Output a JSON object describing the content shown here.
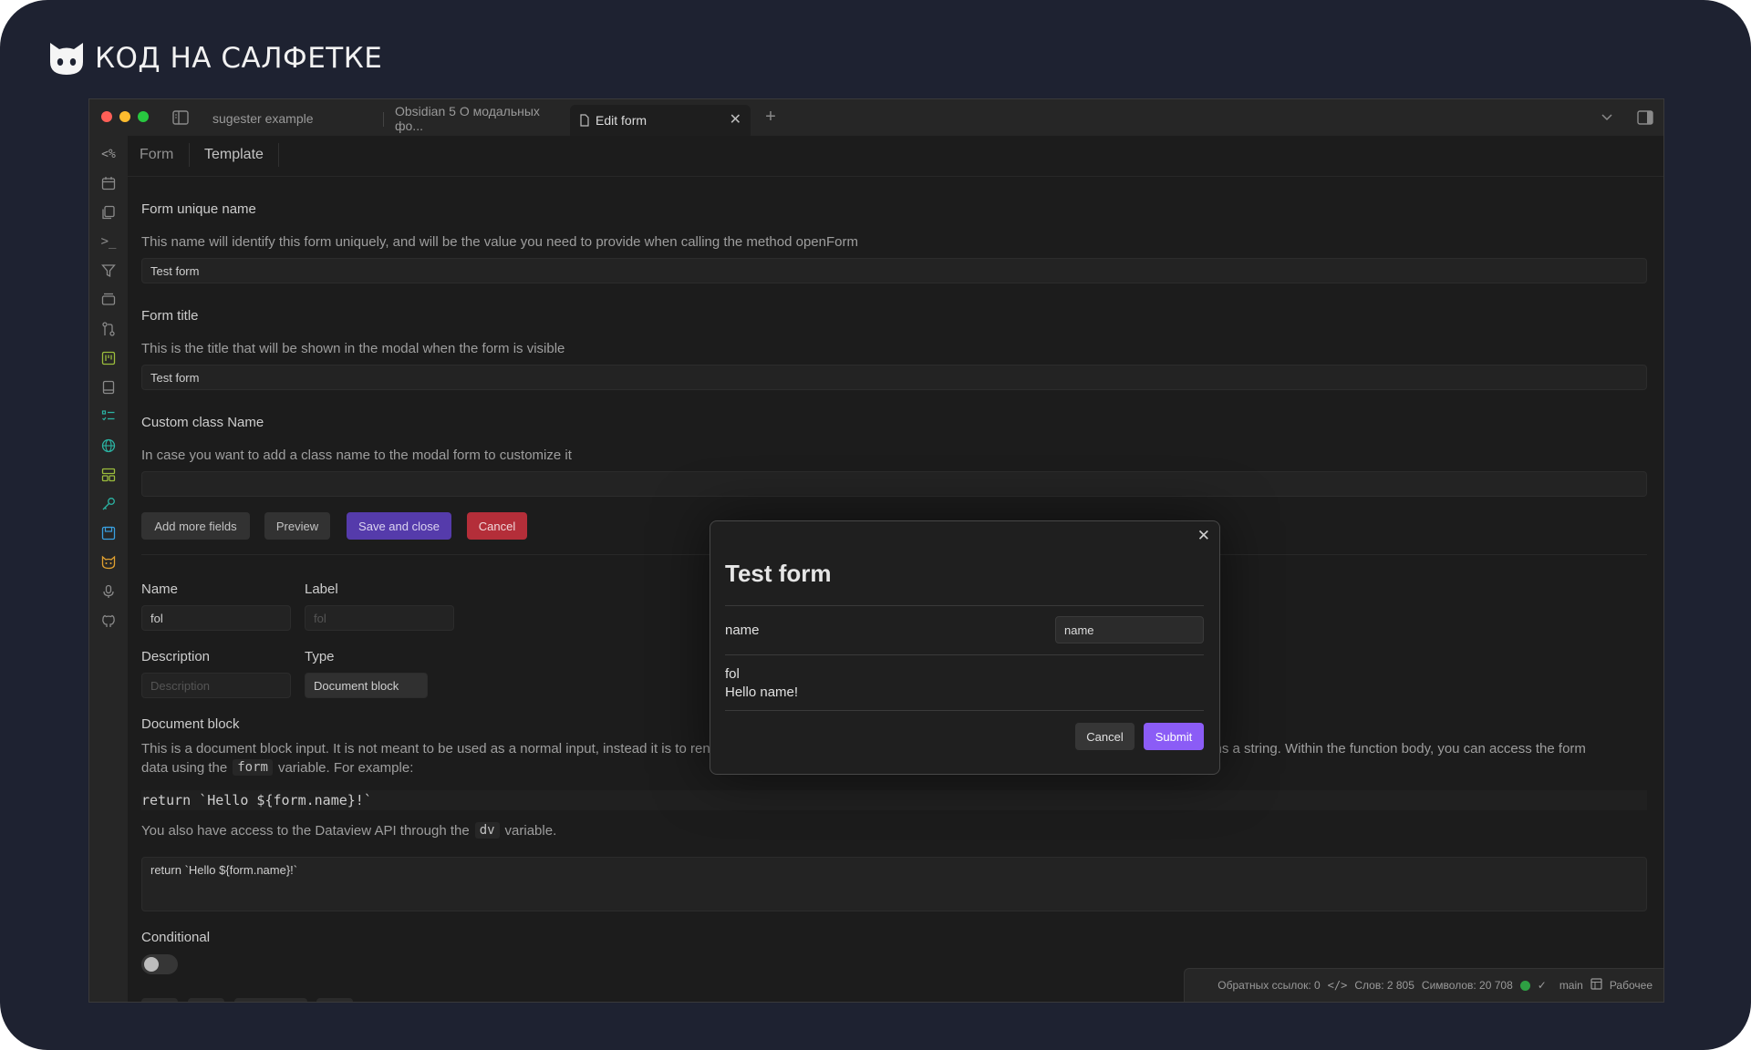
{
  "brand": {
    "text": "КОД НА САЛФЕТКЕ",
    "logo_icon": "cat-face-icon"
  },
  "window": {
    "tabs": [
      {
        "label": "sugester example",
        "active": false
      },
      {
        "label": "Obsidian 5 О модальных фо...",
        "active": false
      },
      {
        "label": "Edit form",
        "active": true
      }
    ],
    "ribbon_icons": [
      "templater-icon",
      "calendar-icon",
      "files-icon",
      "terminal-icon",
      "filter-icon",
      "layers-icon",
      "git-icon",
      "kanban-icon",
      "book-icon",
      "checklist-icon",
      "globe-icon",
      "layout-icon",
      "key-icon",
      "save-icon",
      "cat-icon",
      "mic-icon",
      "github-icon"
    ]
  },
  "nav": {
    "form": "Form",
    "template": "Template"
  },
  "form": {
    "unique_name_label": "Form unique name",
    "unique_name_desc": "This name will identify this form uniquely, and will be the value you need to provide when calling the method openForm",
    "unique_name_value": "Test form",
    "title_label": "Form title",
    "title_desc": "This is the title that will be shown in the modal when the form is visible",
    "title_value": "Test form",
    "class_label": "Custom class Name",
    "class_desc": "In case you want to add a class name to the modal form to customize it",
    "class_value": "",
    "buttons": {
      "add": "Add more fields",
      "preview": "Preview",
      "save": "Save and close",
      "cancel": "Cancel"
    }
  },
  "field": {
    "name_label": "Name",
    "name_value": "fol",
    "label_label": "Label",
    "label_placeholder": "fol",
    "description_label": "Description",
    "description_placeholder": "Description",
    "type_label": "Type",
    "type_value": "Document block",
    "docblock_label": "Document block",
    "docblock_desc1": "This is a document block input. It is not meant to be used as a normal input, instead it is to render some instructions to the user. It is expected to contain a function body that returns a string. Within the function body, you can access the form",
    "docblock_desc2_pre": "data using the",
    "docblock_desc2_code": "form",
    "docblock_desc2_post": "variable. For example:",
    "code_example": "return `Hello ${form.name}!`",
    "dv_pre": "You also have access to the Dataview API through the",
    "dv_code": "dv",
    "dv_post": "variable.",
    "textarea_value": "return `Hello ${form.name}!`",
    "conditional_label": "Conditional"
  },
  "modal": {
    "title": "Test form",
    "field_label": "name",
    "field_value": "name",
    "doc_line1": "fol",
    "doc_line2": "Hello name!",
    "cancel": "Cancel",
    "submit": "Submit"
  },
  "status": {
    "backlinks": "Обратных ссылок: 0",
    "words": "Слов: 2 805",
    "chars": "Символов: 20 708",
    "branch": "main",
    "vault": "Рабочее"
  },
  "colors": {
    "accent": "#8b5cf6",
    "danger": "#c0313d",
    "save": "#5b3fb6"
  }
}
